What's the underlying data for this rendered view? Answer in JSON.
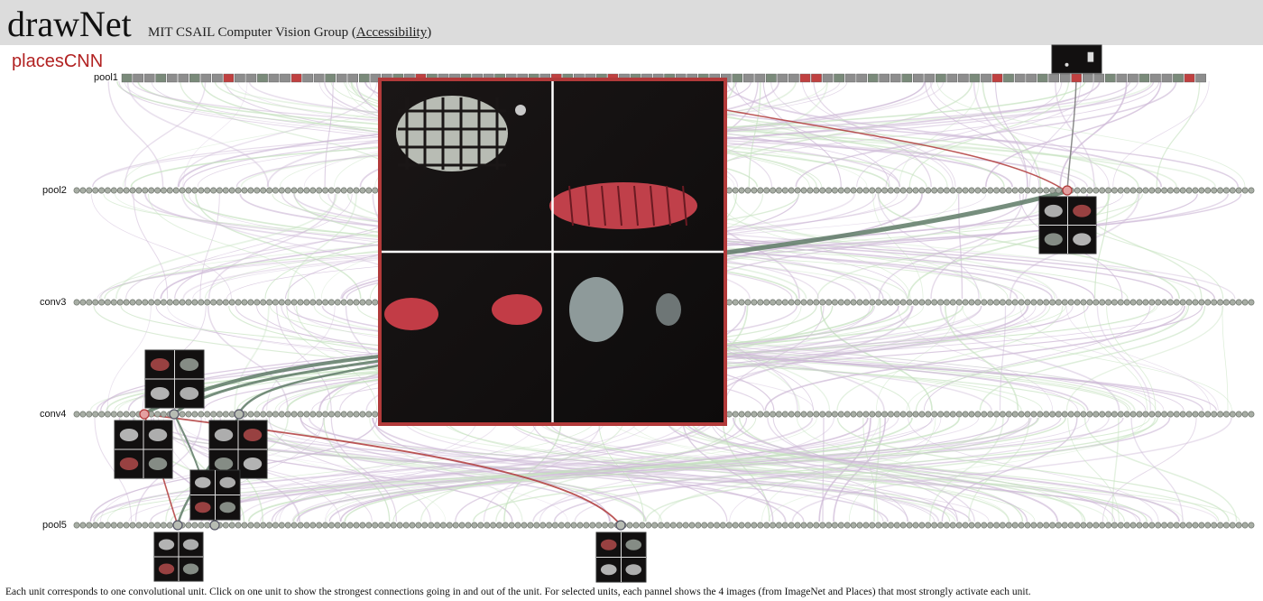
{
  "header": {
    "title": "drawNet",
    "group": "MIT CSAIL Computer Vision Group (",
    "accessibility_link": "Accessibility",
    "group_close": ")"
  },
  "network": {
    "name": "placesCNN",
    "colors": {
      "title": "#b22222",
      "node_fill": "#a8aea5",
      "node_stroke": "#6f756d",
      "node_selected": "#e4a0a0",
      "edge_strong": "#5e7a66",
      "edge_selected": "#b03a3a",
      "panel_border": "#b23a3a",
      "haze_purple": "#cdb8d6",
      "haze_green": "#c6e2c0"
    },
    "layers": [
      {
        "name": "pool1",
        "units": 96
      },
      {
        "name": "pool2",
        "units": 256
      },
      {
        "name": "conv3",
        "units": 384
      },
      {
        "name": "conv4",
        "units": 384
      },
      {
        "name": "pool5",
        "units": 256
      }
    ],
    "unit_panels": [
      {
        "layer": "pool1",
        "images": 1
      },
      {
        "layer": "pool2",
        "images": 4
      },
      {
        "layer": "conv4",
        "images": 4
      },
      {
        "layer": "conv4",
        "images": 4
      },
      {
        "layer": "conv4",
        "images": 4
      },
      {
        "layer": "pool5",
        "images": 4
      },
      {
        "layer": "pool5",
        "images": 4
      },
      {
        "layer": "pool5",
        "images": 4
      }
    ],
    "selected_unit_panel": {
      "images": 4,
      "layer": "conv4"
    }
  },
  "footer": {
    "text": "Each unit corresponds to one convolutional unit. Click on one unit to show the strongest connections going in and out of the unit. For selected units, each pannel shows the 4 images (from ImageNet and Places) that most strongly activate each unit."
  }
}
